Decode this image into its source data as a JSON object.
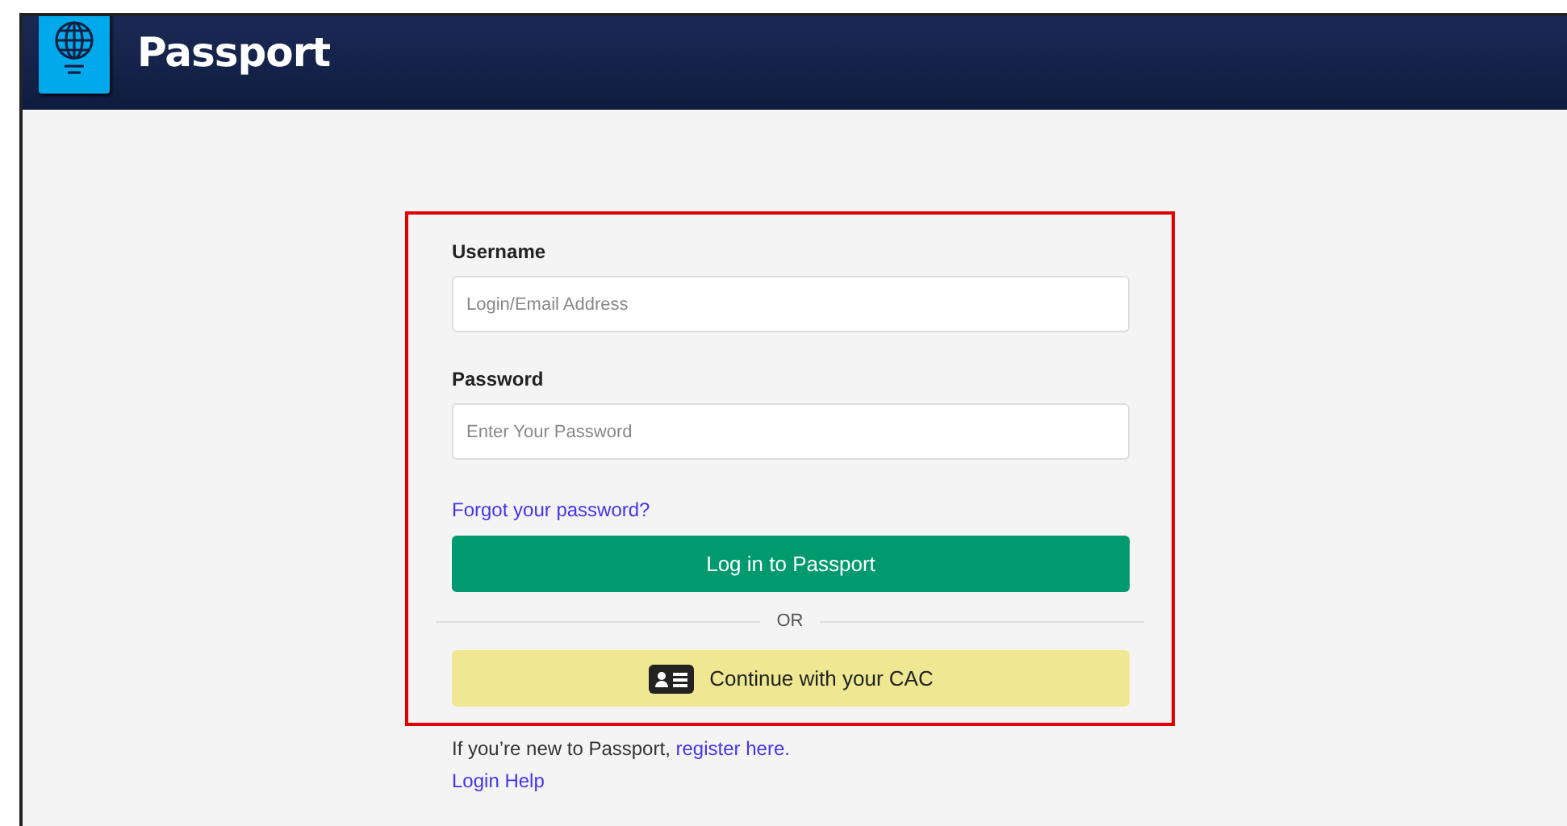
{
  "header": {
    "title": "Passport"
  },
  "form": {
    "fields": [
      {
        "label": "Username",
        "placeholder": "Login/Email Address"
      },
      {
        "label": "Password",
        "placeholder": "Enter Your Password"
      }
    ],
    "forgot_link": "Forgot your password?",
    "login_button": "Log in to Passport",
    "divider": "OR",
    "cac_button": "Continue with your CAC"
  },
  "footer": {
    "new_user_text": "If you’re new to Passport,",
    "register_link": "register here.",
    "help_link": "Login Help"
  }
}
